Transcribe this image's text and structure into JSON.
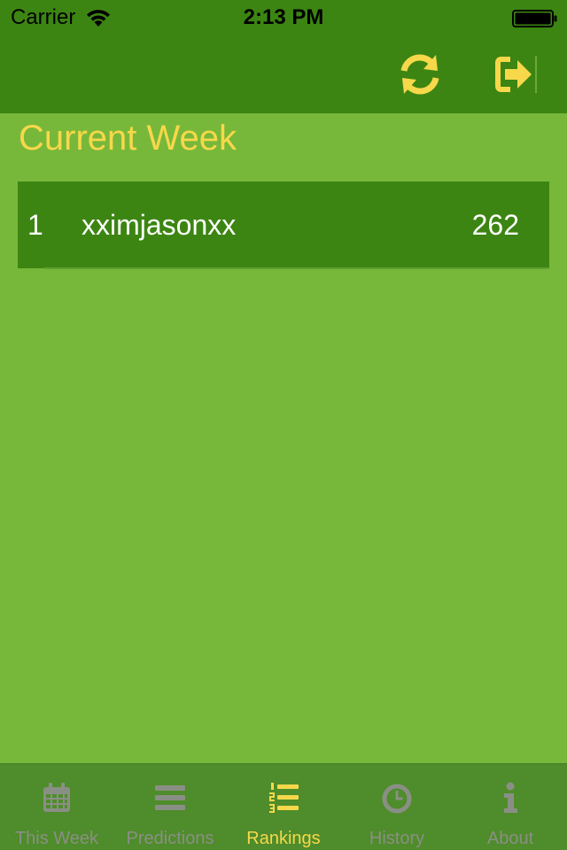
{
  "status_bar": {
    "carrier": "Carrier",
    "time": "2:13 PM",
    "wifi_icon": "wifi-icon",
    "battery_icon": "battery-full-icon"
  },
  "nav": {
    "refresh_icon": "refresh-icon",
    "logout_icon": "sign-out-icon",
    "accent_color": "#f7d84a"
  },
  "main": {
    "title": "Current Week",
    "rankings": [
      {
        "rank": "1",
        "user": "xximjasonxx",
        "score": "262"
      }
    ]
  },
  "tab_bar": {
    "active_index": 2,
    "tabs": [
      {
        "label": "This Week",
        "icon": "calendar-icon"
      },
      {
        "label": "Predictions",
        "icon": "list-icon"
      },
      {
        "label": "Rankings",
        "icon": "ordered-list-icon"
      },
      {
        "label": "History",
        "icon": "clock-icon"
      },
      {
        "label": "About",
        "icon": "info-icon"
      }
    ]
  },
  "colors": {
    "background": "#77b83a",
    "header": "#3c8512",
    "tab_bar": "#4f8c2b",
    "accent": "#f7d84a",
    "inactive_tab": "#8a8f85"
  }
}
